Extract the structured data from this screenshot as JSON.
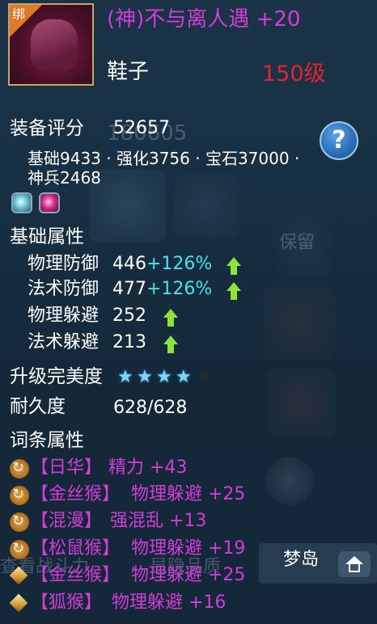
{
  "item": {
    "bind_label": "绑",
    "name": "(神)不与离人遇 +20",
    "slot": "鞋子",
    "level": "150级"
  },
  "score": {
    "label": "装备评分",
    "value": "52657",
    "ghost_value": "180605",
    "breakdown_line1": "基础9433 · 强化3756 · 宝石37000 ·",
    "breakdown_line2": "神兵2468"
  },
  "help_label": "?",
  "gems": [
    "ice-gem-icon",
    "ruby-gem-icon"
  ],
  "basic": {
    "heading": "基础属性",
    "stats": [
      {
        "name": "物理防御",
        "value": "446",
        "bonus": "+126%"
      },
      {
        "name": "法术防御",
        "value": "477",
        "bonus": "+126%"
      },
      {
        "name": "物理躲避",
        "value": "252",
        "bonus": ""
      },
      {
        "name": "法术躲避",
        "value": "213",
        "bonus": ""
      }
    ]
  },
  "upgrade": {
    "label": "升级完美度",
    "stars_filled": 4,
    "stars_total": 5
  },
  "durability": {
    "label": "耐久度",
    "value": "628/628"
  },
  "affixes": {
    "heading": "词条属性",
    "items": [
      {
        "icon": "refresh-icon",
        "tag": "【日华】",
        "text": "精力 +43"
      },
      {
        "icon": "refresh-icon",
        "tag": "【金丝猴】",
        "text": "物理躲避 +25"
      },
      {
        "icon": "refresh-icon",
        "tag": "【混漫】",
        "text": "强混乱 +13"
      },
      {
        "icon": "refresh-icon",
        "tag": "【松鼠猴】",
        "text": "物理躲避 +19"
      },
      {
        "icon": "diamond-icon",
        "tag": "【金丝猴】",
        "text": "物理躲避 +25"
      },
      {
        "icon": "diamond-icon",
        "tag": "【狐猴】",
        "text": "物理躲避 +16"
      }
    ]
  },
  "background": {
    "ghost_left": "查看战斗力",
    "ghost_mid": "显隐品质",
    "ghost_right": "保留",
    "bottom_button": "梦岛"
  },
  "colors": {
    "title": "#d23cd8",
    "level": "#e0252c",
    "bonus": "#46e2ee",
    "arrow": "#8ee23a",
    "star": "#7fd3ff"
  }
}
